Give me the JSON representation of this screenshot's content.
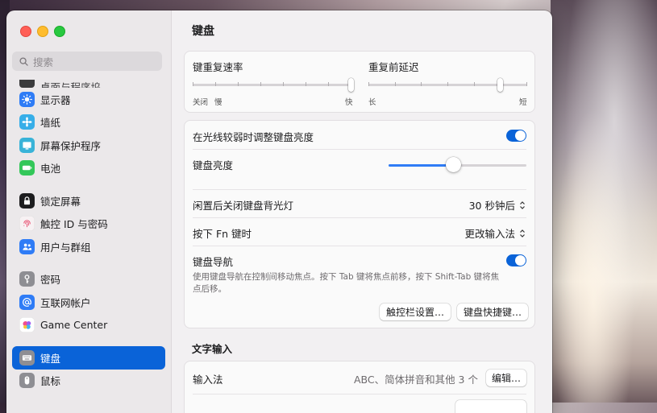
{
  "sidebar": {
    "search_placeholder": "搜索",
    "cut_item": "桌面与程序坞",
    "items": [
      {
        "label": "显示器",
        "icon": "display-icon",
        "color": "#2f7cf6"
      },
      {
        "label": "墙纸",
        "icon": "wallpaper-icon",
        "color": "#37aee8"
      },
      {
        "label": "屏幕保护程序",
        "icon": "screensaver-icon",
        "color": "#39b3d8"
      },
      {
        "label": "电池",
        "icon": "battery-icon",
        "color": "#33c759"
      },
      {
        "label": "锁定屏幕",
        "icon": "lock-icon",
        "color": "#1d1d1f"
      },
      {
        "label": "触控 ID 与密码",
        "icon": "fingerprint-icon",
        "color": "#f7f1f3"
      },
      {
        "label": "用户与群组",
        "icon": "users-icon",
        "color": "#2f7cf6"
      },
      {
        "label": "密码",
        "icon": "key-icon",
        "color": "#8e8e93"
      },
      {
        "label": "互联网帐户",
        "icon": "at-icon",
        "color": "#2f7cf6"
      },
      {
        "label": "Game Center",
        "icon": "game-center-icon",
        "color": "#ffffff"
      },
      {
        "label": "键盘",
        "icon": "keyboard-icon",
        "color": "#8e8e93"
      },
      {
        "label": "鼠标",
        "icon": "mouse-icon",
        "color": "#8e8e93"
      }
    ]
  },
  "main": {
    "title": "键盘",
    "repeat_rate": {
      "label": "键重复速率",
      "left": "关闭",
      "slow": "慢",
      "fast": "快",
      "value_step": 7,
      "steps": 8
    },
    "delay": {
      "label": "重复前延迟",
      "long": "长",
      "short": "短",
      "value_step": 5,
      "steps": 7
    },
    "auto_brightness": {
      "label": "在光线较弱时调整键盘亮度",
      "on": true
    },
    "brightness": {
      "label": "键盘亮度",
      "value": 0.47
    },
    "backlight_off": {
      "label": "闲置后关闭键盘背光灯",
      "value": "30 秒钟后"
    },
    "fn_key": {
      "label": "按下 Fn 键时",
      "value": "更改输入法"
    },
    "keyboard_nav": {
      "label": "键盘导航",
      "on": true,
      "desc": "使用键盘导航在控制间移动焦点。按下 Tab 键将焦点前移，按下 Shift-Tab 键将焦点后移。"
    },
    "touchbar_button": "触控栏设置…",
    "shortcuts_button": "键盘快捷键…",
    "text_input_title": "文字输入",
    "input_method": {
      "label": "输入法",
      "value": "ABC、简体拼音和其他 3 个",
      "edit": "编辑…"
    }
  },
  "colors": {
    "accent": "#0a63d8"
  }
}
